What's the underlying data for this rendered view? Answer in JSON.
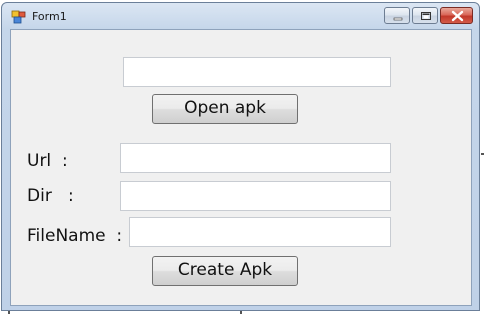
{
  "window": {
    "title": "Form1",
    "icon": "form-app-icon",
    "caption_buttons": [
      "minimize-icon",
      "maximize-icon",
      "close-icon"
    ]
  },
  "apk_path": {
    "value": "",
    "placeholder": ""
  },
  "open_button": {
    "label": "Open apk"
  },
  "fields": {
    "url": {
      "label": "Url  :",
      "value": ""
    },
    "dir": {
      "label": "Dir   :",
      "value": ""
    },
    "filename": {
      "label": "FileName  :",
      "value": ""
    }
  },
  "create_button": {
    "label": "Create Apk"
  },
  "colors": {
    "client_bg": "#f0f0f0",
    "title_bar": "#c5d6ea",
    "close_button": "#c2382a"
  }
}
